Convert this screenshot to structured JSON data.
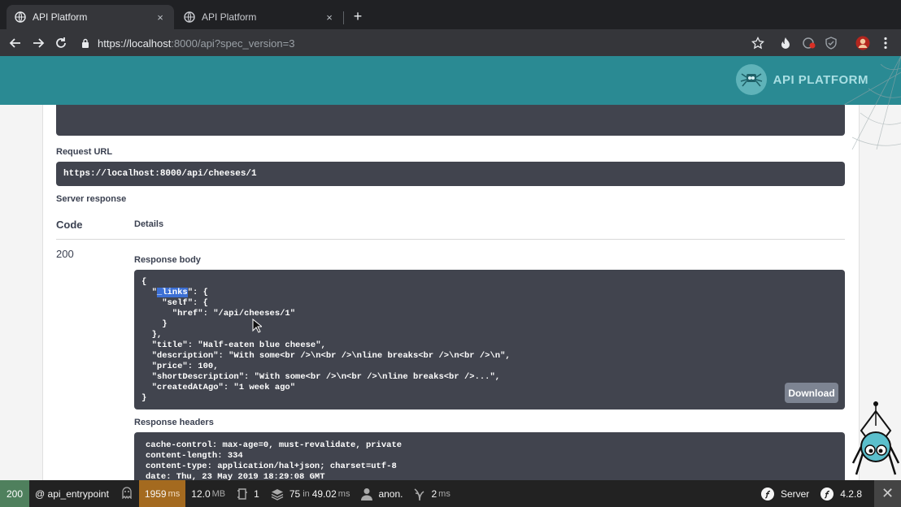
{
  "browser": {
    "tabs": [
      {
        "title": "API Platform",
        "close": "×"
      },
      {
        "title": "API Platform",
        "close": "×"
      }
    ],
    "new_tab": "+",
    "url_host": "https://localhost",
    "url_path": ":8000/api?spec_version=3"
  },
  "header": {
    "brand_name": "API PLATFORM"
  },
  "response": {
    "request_url_label": "Request URL",
    "request_url": "https://localhost:8000/api/cheeses/1",
    "server_response_label": "Server response",
    "col_code": "Code",
    "col_details": "Details",
    "code": "200",
    "body_label": "Response body",
    "body_open": "{",
    "body_links_pre": "  \"",
    "body_links_key": "_links",
    "body_links_post": "\": {",
    "body_rest": "    \"self\": {\n      \"href\": \"/api/cheeses/1\"\n    }\n  },\n  \"title\": \"Half-eaten blue cheese\",\n  \"description\": \"With some<br />\\n<br />\\nline breaks<br />\\n<br />\\n\",\n  \"price\": 100,\n  \"shortDescription\": \"With some<br />\\n<br />\\nline breaks<br />...\",\n  \"createdAtAgo\": \"1 week ago\"\n}",
    "download_label": "Download",
    "headers_label": "Response headers",
    "headers_text": "cache-control: max-age=0, must-revalidate, private\ncontent-length: 334\ncontent-type: application/hal+json; charset=utf-8\ndate: Thu, 23 May 2019 18:29:08 GMT"
  },
  "debug_toolbar": {
    "status": "200",
    "route": "@ api_entrypoint",
    "time_value": "1959",
    "time_unit": "ms",
    "memory_value": "12.0",
    "memory_unit": "MB",
    "forms_count": "1",
    "db_queries": "75",
    "db_in": "in",
    "db_time": "49.02",
    "db_unit": "ms",
    "user": "anon.",
    "twig_value": "2",
    "twig_unit": "ms",
    "server_label": "Server",
    "version": "4.2.8",
    "close": "✕"
  },
  "colors": {
    "header_teal": "#2a8a93",
    "code_bg": "#41444e",
    "status_green": "#4f805d",
    "time_orange": "#a46a1f"
  }
}
